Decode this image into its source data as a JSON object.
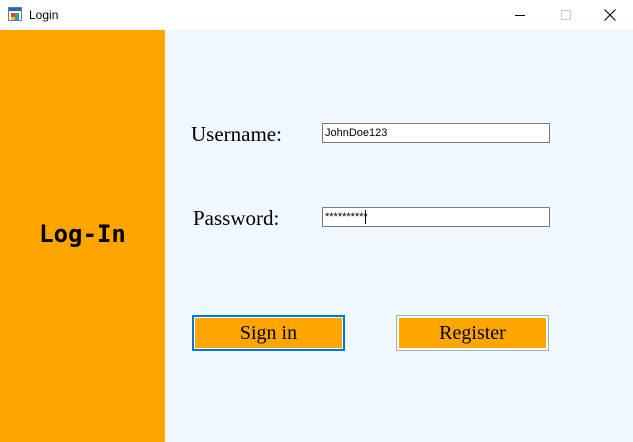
{
  "window": {
    "title": "Login",
    "app_icon": "windows-form-icon",
    "controls": {
      "minimize_icon": "minimize-icon",
      "maximize_icon": "maximize-icon",
      "close_icon": "close-icon"
    }
  },
  "side_panel": {
    "title": "Log-In",
    "color": "#ffa500"
  },
  "form": {
    "background": "#f0f8ff",
    "username_label": "Username:",
    "username_value": "JohnDoe123",
    "password_label": "Password:",
    "password_value": "**********",
    "signin_label": "Sign in",
    "register_label": "Register",
    "button_color": "#ffa500",
    "focus_color": "#0078d7"
  }
}
